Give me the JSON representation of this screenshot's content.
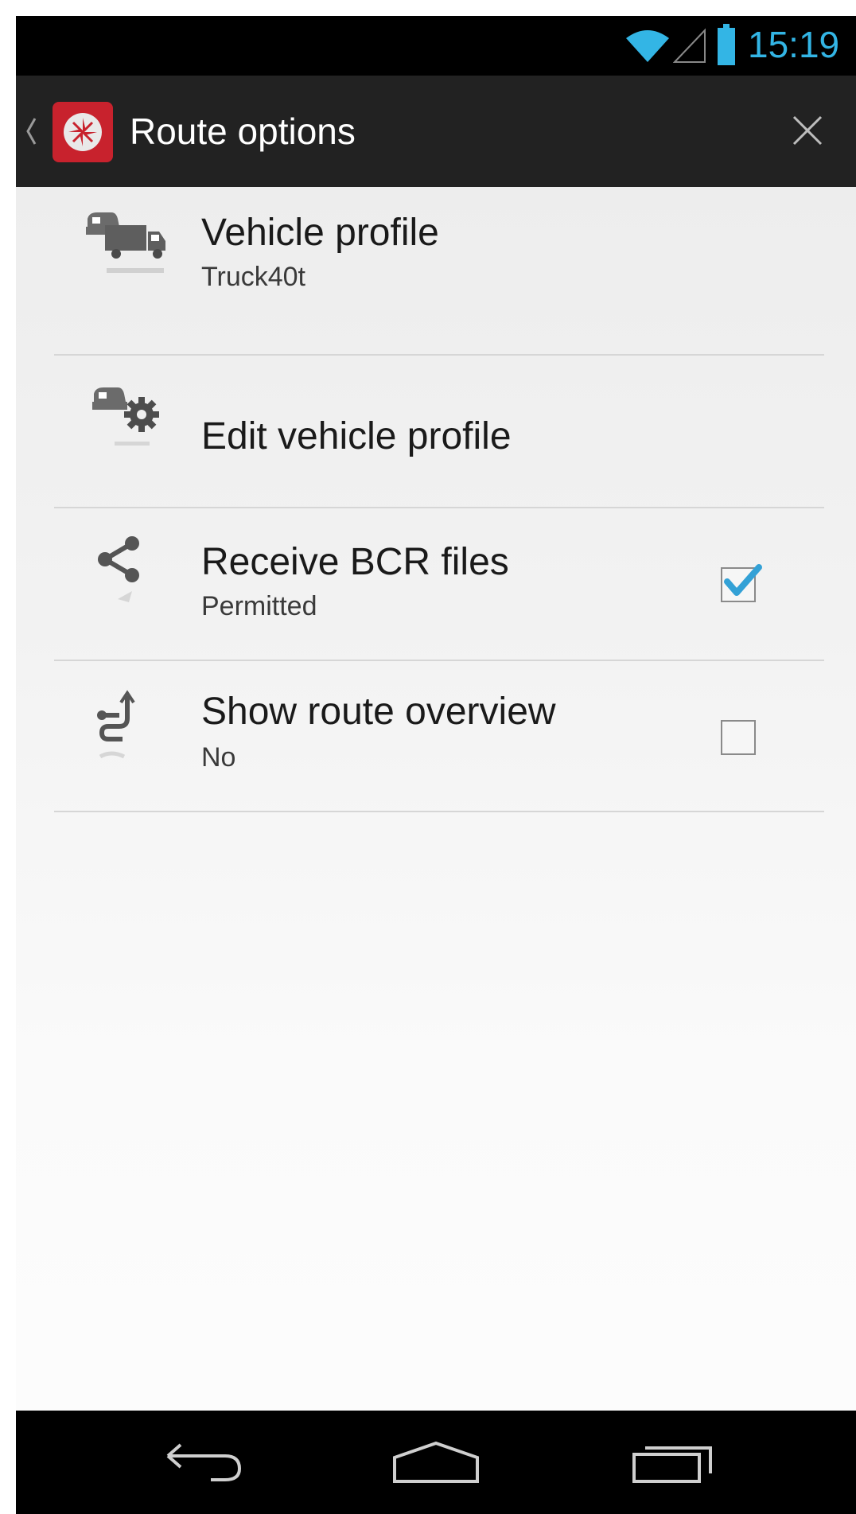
{
  "status_bar": {
    "time": "15:19",
    "accent_color": "#33b5e5",
    "icons": [
      "wifi-icon",
      "signal-icon",
      "battery-icon"
    ]
  },
  "action_bar": {
    "title": "Route options",
    "app_icon": "compass-app-icon",
    "close_icon": "close-icon",
    "brand_color": "#c8222d"
  },
  "options": [
    {
      "title": "Vehicle profile",
      "subtitle": "Truck40t",
      "icon": "vehicle-profile-icon"
    },
    {
      "title": "Edit vehicle profile",
      "icon": "edit-vehicle-settings-icon"
    },
    {
      "title": "Receive BCR files",
      "subtitle": "Permitted",
      "icon": "share-icon",
      "checked": true
    },
    {
      "title": "Show route overview",
      "subtitle": "No",
      "icon": "route-overview-icon",
      "checked": false
    }
  ],
  "nav_bar": {
    "icons": [
      "back-icon",
      "home-icon",
      "recents-icon"
    ]
  }
}
